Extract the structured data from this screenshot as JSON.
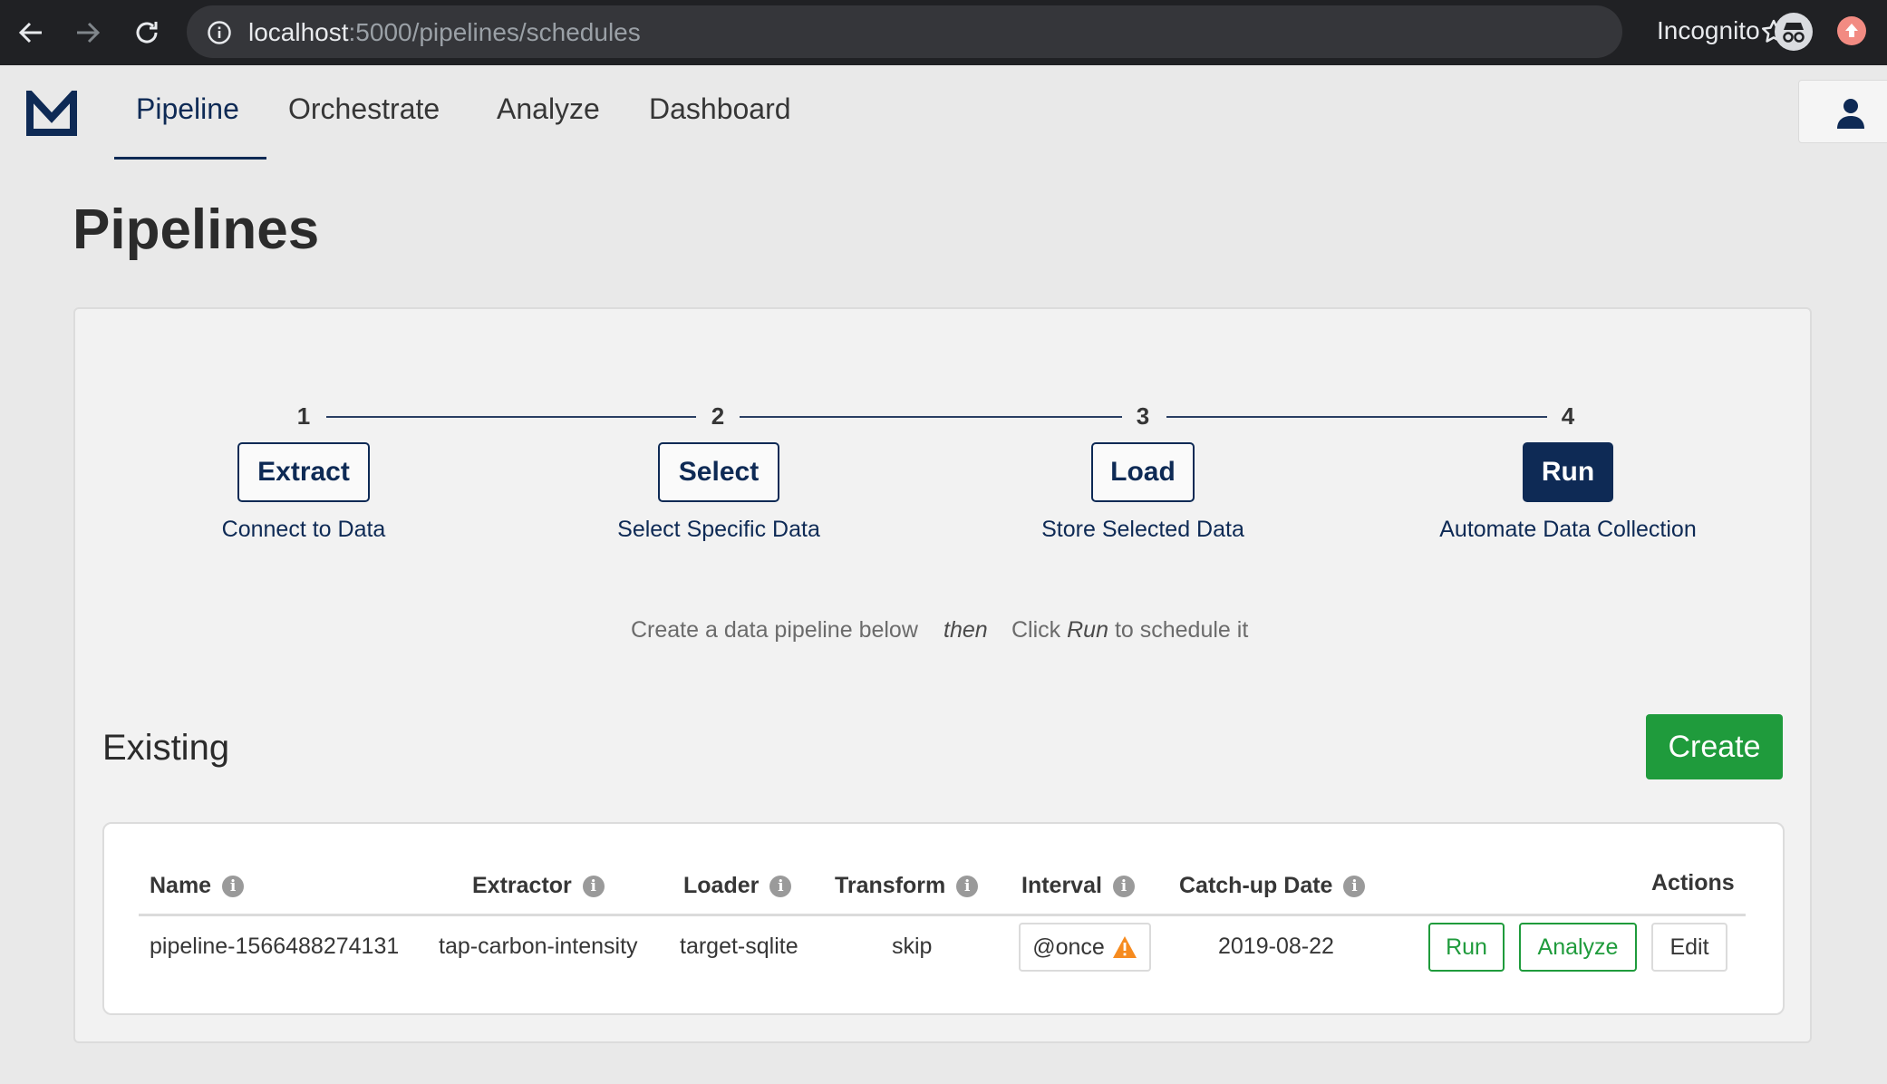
{
  "browser": {
    "url_host": "localhost",
    "url_path": ":5000/pipelines/schedules",
    "incognito_label": "Incognito"
  },
  "nav": {
    "tabs": [
      {
        "label": "Pipeline",
        "active": true
      },
      {
        "label": "Orchestrate",
        "active": false
      },
      {
        "label": "Analyze",
        "active": false
      },
      {
        "label": "Dashboard",
        "active": false
      }
    ]
  },
  "page": {
    "title": "Pipelines"
  },
  "steps": [
    {
      "number": "1",
      "label": "Extract",
      "subtitle": "Connect to Data",
      "filled": false
    },
    {
      "number": "2",
      "label": "Select",
      "subtitle": "Select Specific Data",
      "filled": false
    },
    {
      "number": "3",
      "label": "Load",
      "subtitle": "Store Selected Data",
      "filled": false
    },
    {
      "number": "4",
      "label": "Run",
      "subtitle": "Automate Data Collection",
      "filled": true
    }
  ],
  "hint": {
    "part1": "Create a data pipeline below",
    "then": "then",
    "part2": "Click",
    "run": "Run",
    "part3": "to schedule it"
  },
  "existing": {
    "heading": "Existing",
    "create_label": "Create"
  },
  "table": {
    "headers": {
      "name": "Name",
      "extractor": "Extractor",
      "loader": "Loader",
      "transform": "Transform",
      "interval": "Interval",
      "catchup": "Catch-up Date",
      "actions": "Actions"
    },
    "rows": [
      {
        "name": "pipeline-1566488274131",
        "extractor": "tap-carbon-intensity",
        "loader": "target-sqlite",
        "transform": "skip",
        "interval": "@once",
        "catchup": "2019-08-22",
        "run_label": "Run",
        "analyze_label": "Analyze",
        "edit_label": "Edit"
      }
    ]
  },
  "colors": {
    "primary": "#0e2a55",
    "success": "#1f9b3c",
    "warning": "#f68b1f",
    "chrome": "#202124"
  }
}
